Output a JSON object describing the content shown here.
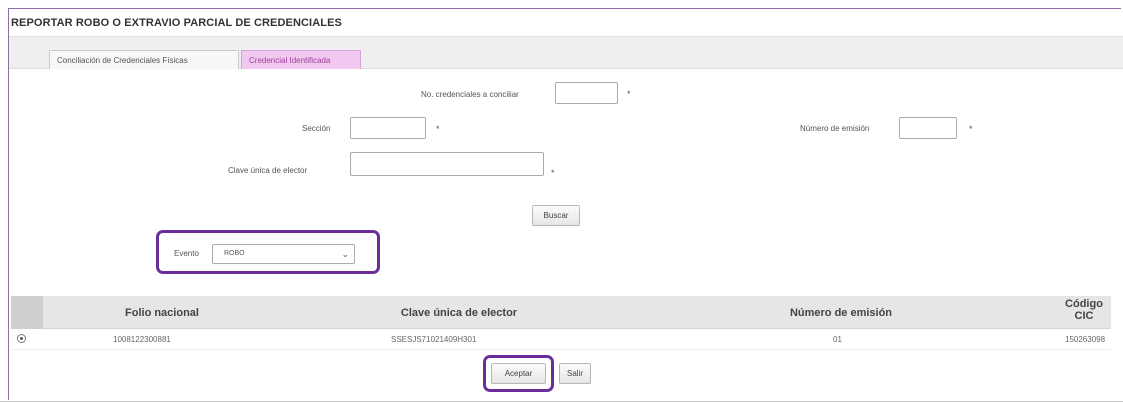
{
  "page": {
    "title": "REPORTAR ROBO O EXTRAVIO PARCIAL DE CREDENCIALES"
  },
  "tabs": [
    {
      "label": "Conciliación de Credenciales Físicas",
      "active": false
    },
    {
      "label": "Credencial Identificada",
      "active": true
    }
  ],
  "form": {
    "no_credenciales_label": "No. credenciales a conciliar",
    "seccion_label": "Sección",
    "numero_emision_label": "Número de emisión",
    "clave_label": "Clave única de elector",
    "required_mark": "*",
    "buscar_label": "Buscar",
    "evento_label": "Evento",
    "evento_selected": "ROBO"
  },
  "table": {
    "headers": [
      "Folio nacional",
      "Clave única de elector",
      "Número de emisión",
      "Código CIC"
    ],
    "rows": [
      {
        "folio": "1008122300881",
        "clave": "SSESJS71021409H301",
        "emision": "01",
        "cic": "150263098"
      }
    ]
  },
  "actions": {
    "aceptar_label": "Aceptar",
    "salir_label": "Salir"
  },
  "colors": {
    "accent": "#6a2e9b",
    "active_tab": "#f0c8f0",
    "header_bg": "#e6e6e6"
  }
}
